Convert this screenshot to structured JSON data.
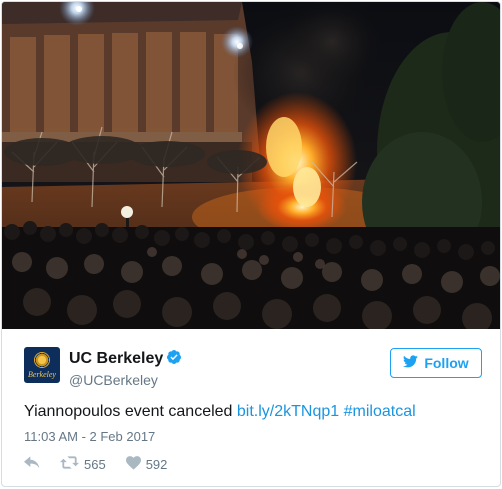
{
  "tweet": {
    "author": {
      "display_name": "UC Berkeley",
      "handle": "@UCBerkeley",
      "verified": true,
      "avatar_wordmark": "Berkeley"
    },
    "follow_label": "Follow",
    "text": "Yiannopoulos event canceled",
    "link": "bit.ly/2kTNqp1",
    "hashtag": "#miloatcal",
    "timestamp": "11:03 AM - 2 Feb 2017",
    "retweets": "565",
    "likes": "592"
  },
  "icons": {
    "reply": "reply-icon",
    "retweet": "retweet-icon",
    "like": "heart-icon",
    "verified": "verified-badge-icon",
    "follow": "twitter-bird-icon"
  },
  "colors": {
    "accent": "#1da1f2",
    "link": "#1b95e0",
    "text": "#14171a",
    "muted": "#657786",
    "border": "#d6dde3"
  }
}
